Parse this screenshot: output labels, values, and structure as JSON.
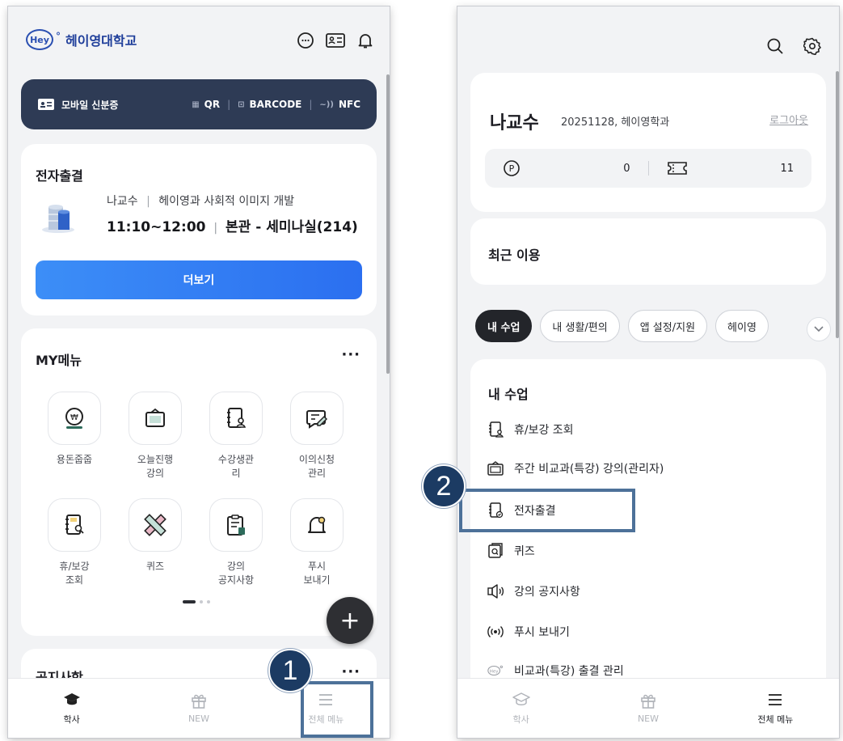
{
  "left": {
    "logo": {
      "badge": "Hey",
      "name": "헤이영대학교"
    },
    "id_card": {
      "label": "모바일 신분증",
      "qr": "QR",
      "barcode": "BARCODE",
      "nfc": "NFC"
    },
    "attendance": {
      "title": "전자출결",
      "professor": "나교수",
      "course": "헤이영과 사회적 이미지 개발",
      "time": "11:10~12:00",
      "room": "본관 - 세미나실(214)",
      "more_button": "더보기"
    },
    "my_menu": {
      "title": "MY메뉴",
      "more": "···",
      "items": [
        {
          "label_l1": "용돈줍줍",
          "label_l2": ""
        },
        {
          "label_l1": "오늘진행",
          "label_l2": "강의"
        },
        {
          "label_l1": "수강생관",
          "label_l2": "리"
        },
        {
          "label_l1": "이의신청",
          "label_l2": "관리"
        },
        {
          "label_l1": "휴/보강",
          "label_l2": "조회"
        },
        {
          "label_l1": "퀴즈",
          "label_l2": ""
        },
        {
          "label_l1": "강의",
          "label_l2": "공지사항"
        },
        {
          "label_l1": "푸시",
          "label_l2": "보내기"
        }
      ],
      "fab": "+"
    },
    "notice": {
      "title": "공지사항",
      "more": "···"
    },
    "nav": [
      {
        "label": "학사"
      },
      {
        "label": "NEW"
      },
      {
        "label": "전체 메뉴"
      }
    ],
    "step": "1"
  },
  "right": {
    "profile": {
      "name": "나교수",
      "meta": "20251128, 헤이영학과",
      "logout": "로그아웃",
      "points": "0",
      "tickets": "11"
    },
    "recent": {
      "title": "최근 이용"
    },
    "chips": [
      {
        "label": "내 수업"
      },
      {
        "label": "내 생활/편의"
      },
      {
        "label": "앱 설정/지원"
      },
      {
        "label": "헤이영"
      }
    ],
    "menu": {
      "title": "내 수업",
      "items": [
        {
          "label": "휴/보강 조회"
        },
        {
          "label": "주간 비교과(특강) 강의(관리자)"
        },
        {
          "label": "전자출결"
        },
        {
          "label": "퀴즈"
        },
        {
          "label": "강의 공지사항"
        },
        {
          "label": "푸시 보내기"
        },
        {
          "label": "비교과(특강) 출결 관리"
        }
      ]
    },
    "nav": [
      {
        "label": "학사"
      },
      {
        "label": "NEW"
      },
      {
        "label": "전체 메뉴"
      }
    ],
    "step": "2"
  },
  "colors": {
    "accent": "#2b6ff0",
    "id_card": "#2e3b55",
    "step_badge": "#1c3b63",
    "highlight": "#4d7199"
  }
}
